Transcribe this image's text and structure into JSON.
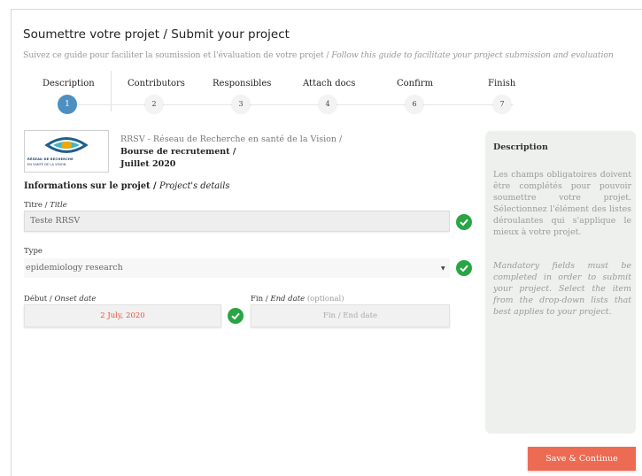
{
  "header": {
    "title": "Soumettre votre projet / Submit your project",
    "subtitle_fr": "Suivez ce guide pour faciliter la soumission et l'évaluation de votre projet / ",
    "subtitle_en": "Follow this guide to facilitate your project submission and evaluation"
  },
  "stepper": {
    "steps": [
      {
        "label": "Description",
        "number": "1"
      },
      {
        "label": "Contributors",
        "number": "2"
      },
      {
        "label": "Responsibles",
        "number": "3"
      },
      {
        "label": "Attach docs",
        "number": "4"
      },
      {
        "label": "Confirm",
        "number": "6"
      },
      {
        "label": "Finish",
        "number": "7"
      }
    ],
    "active_index": 0
  },
  "project": {
    "logo_text1": "RÉSEAU DE RECHERCHE",
    "logo_text2": "EN SANTÉ DE LA VISION",
    "org_line1": "RRSV - Réseau de Recherche en santé de la Vision /",
    "org_line2": "Bourse de recrutement /",
    "org_line3": "Juillet 2020"
  },
  "section": {
    "title_fr": "Informations sur le projet / ",
    "title_en": "Project's details"
  },
  "fields": {
    "title_label_fr": "Titre / ",
    "title_label_en": "Title",
    "title_value": "Teste RRSV",
    "type_label": "Type",
    "type_value": "epidemiology research",
    "start_label_fr": "Début / ",
    "start_label_en": "Onset date",
    "start_value": "2 July, 2020",
    "end_label_fr": "Fin / ",
    "end_label_en": "End date",
    "end_label_optional": " (optional)",
    "end_placeholder": "Fin / End date"
  },
  "description": {
    "title": "Description",
    "text_fr": "Les champs obligatoires doivent être complétés pour pouvoir soumettre votre projet. Sélectionnez l'élément des listes déroulantes qui s'applique le mieux à votre projet.",
    "text_en": "Mandatory fields must be completed in order to submit your project. Select the item from the drop-down lists that best applies to your project."
  },
  "actions": {
    "save_label": "Save & Continue"
  },
  "colors": {
    "accent_blue": "#4d8fc0",
    "check_green": "#2aa545",
    "button_orange": "#ec6b52",
    "date_red": "#e0553a"
  }
}
